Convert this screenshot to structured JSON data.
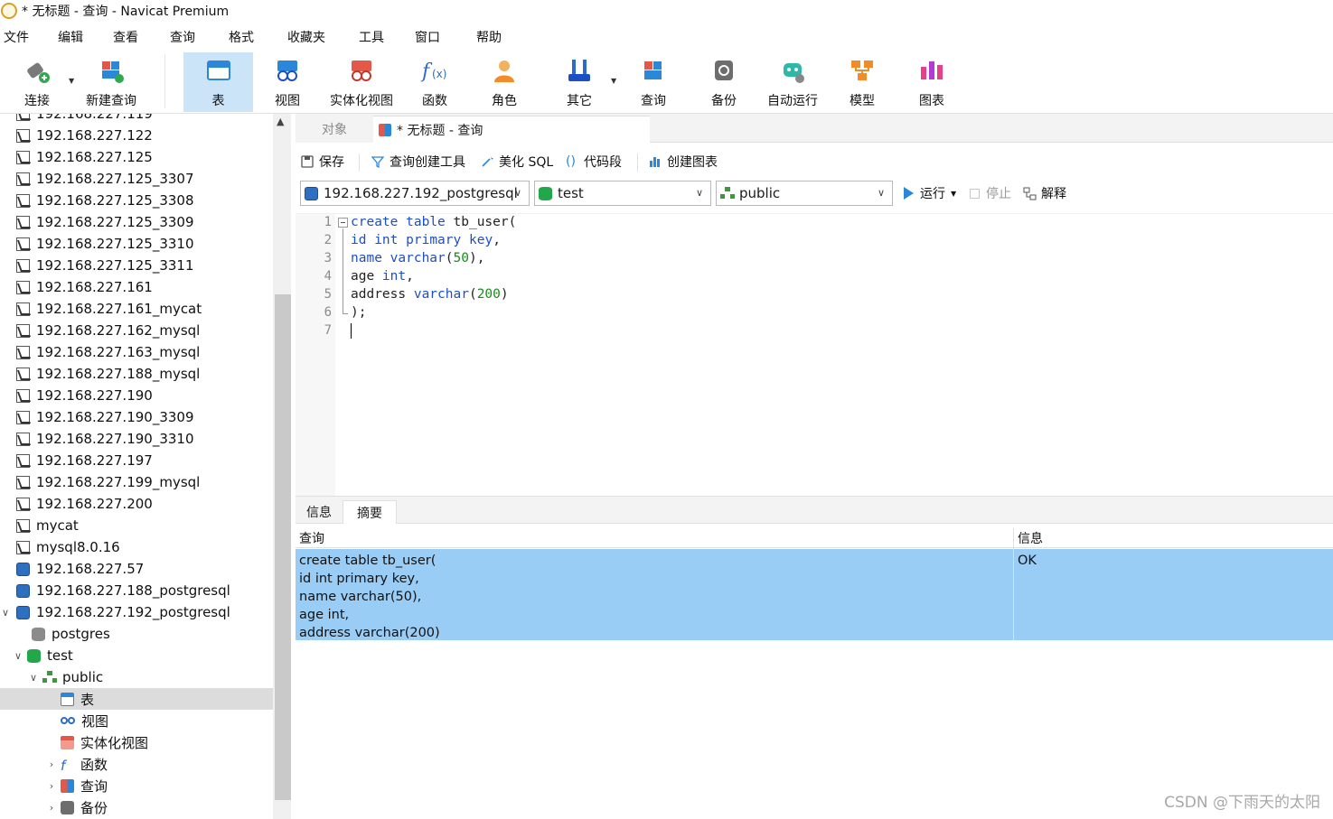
{
  "window": {
    "title": "* 无标题 - 查询 - Navicat Premium"
  },
  "menu": [
    "文件",
    "编辑",
    "查看",
    "查询",
    "格式",
    "收藏夹",
    "工具",
    "窗口",
    "帮助"
  ],
  "toolbar": {
    "connect": "连接",
    "new_query": "新建查询",
    "table": "表",
    "view": "视图",
    "materialized_view": "实体化视图",
    "function": "函数",
    "role": "角色",
    "other": "其它",
    "query": "查询",
    "backup": "备份",
    "auto_run": "自动运行",
    "model": "模型",
    "chart": "图表"
  },
  "tree": {
    "partial_top": "192.168.227.119",
    "connections": [
      "192.168.227.122",
      "192.168.227.125",
      "192.168.227.125_3307",
      "192.168.227.125_3308",
      "192.168.227.125_3309",
      "192.168.227.125_3310",
      "192.168.227.125_3311",
      "192.168.227.161",
      "192.168.227.161_mycat",
      "192.168.227.162_mysql",
      "192.168.227.163_mysql",
      "192.168.227.188_mysql",
      "192.168.227.190",
      "192.168.227.190_3309",
      "192.168.227.190_3310",
      "192.168.227.197",
      "192.168.227.199_mysql",
      "192.168.227.200",
      "mycat",
      "mysql8.0.16"
    ],
    "pg_connections": [
      "192.168.227.57",
      "192.168.227.188_postgresql",
      "192.168.227.192_postgresql"
    ],
    "databases": [
      "postgres",
      "test"
    ],
    "schema": "public",
    "schema_children": [
      "表",
      "视图",
      "实体化视图",
      "函数",
      "查询",
      "备份"
    ]
  },
  "tabs": {
    "objects": "对象",
    "query": "* 无标题 - 查询"
  },
  "query_tools": {
    "save": "保存",
    "query_builder": "查询创建工具",
    "beautify": "美化 SQL",
    "snippet": "代码段",
    "create_chart": "创建图表"
  },
  "selectors": {
    "connection": "192.168.227.192_postgresql",
    "database": "test",
    "schema": "public",
    "run": "运行",
    "stop": "停止",
    "explain": "解释"
  },
  "editor": {
    "line_numbers": [
      "1",
      "2",
      "3",
      "4",
      "5",
      "6",
      "7"
    ],
    "lines": [
      [
        {
          "t": "create",
          "k": "kw"
        },
        {
          "t": " "
        },
        {
          "t": "table",
          "k": "kw"
        },
        {
          "t": " tb_user("
        }
      ],
      [
        {
          "t": "id",
          "k": "kw"
        },
        {
          "t": " "
        },
        {
          "t": "int",
          "k": "kw"
        },
        {
          "t": " "
        },
        {
          "t": "primary",
          "k": "kw"
        },
        {
          "t": " "
        },
        {
          "t": "key",
          "k": "kw"
        },
        {
          "t": ","
        }
      ],
      [
        {
          "t": "name",
          "k": "kw"
        },
        {
          "t": " "
        },
        {
          "t": "varchar",
          "k": "kw"
        },
        {
          "t": "("
        },
        {
          "t": "50",
          "k": "num"
        },
        {
          "t": "),"
        }
      ],
      [
        {
          "t": "age "
        },
        {
          "t": "int",
          "k": "kw"
        },
        {
          "t": ","
        }
      ],
      [
        {
          "t": "address "
        },
        {
          "t": "varchar",
          "k": "kw"
        },
        {
          "t": "("
        },
        {
          "t": "200",
          "k": "num"
        },
        {
          "t": ")"
        }
      ],
      [
        {
          "t": ");"
        }
      ],
      []
    ]
  },
  "results": {
    "tabs": {
      "info": "信息",
      "summary": "摘要"
    },
    "columns": {
      "query": "查询",
      "info": "信息"
    },
    "row": {
      "query": "create table tb_user(\nid int primary key,\nname varchar(50),\nage int,\naddress varchar(200)",
      "info": "OK"
    }
  },
  "watermark": "CSDN @下雨天的太阳",
  "colors": {
    "accent": "#2b88d8",
    "selection": "#99cdf5",
    "active_toolbar": "#cce4f7",
    "keyword": "#1d4fc4",
    "number": "#1a8a1a"
  }
}
